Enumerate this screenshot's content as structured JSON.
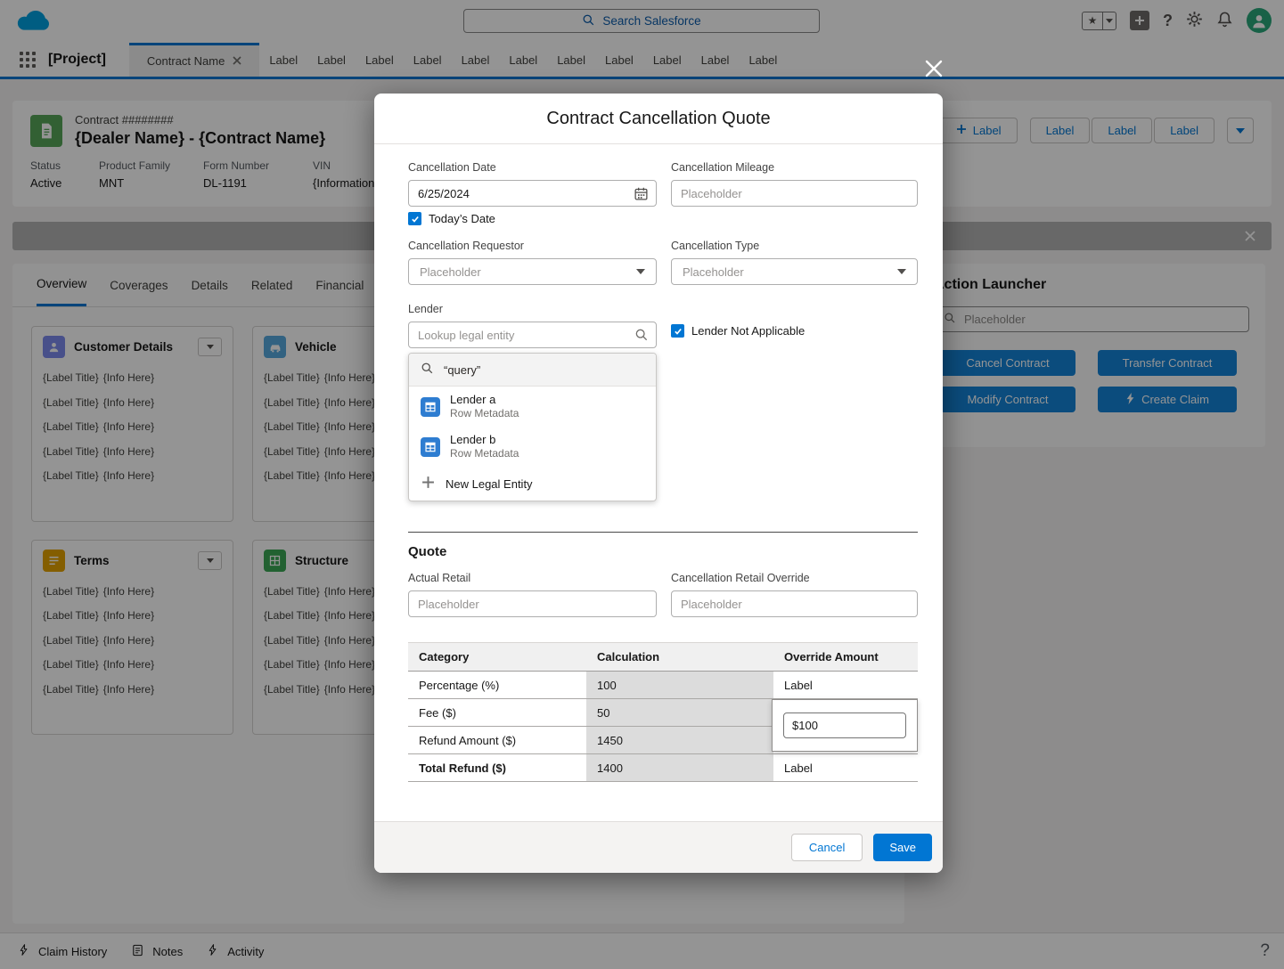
{
  "header": {
    "search_placeholder": "Search Salesforce"
  },
  "nav": {
    "project": "[Project]",
    "active_tab": "Contract Name",
    "tabs": [
      "Label",
      "Label",
      "Label",
      "Label",
      "Label",
      "Label",
      "Label",
      "Label",
      "Label",
      "Label",
      "Label"
    ]
  },
  "record": {
    "type_label": "Contract ########",
    "title": "{Dealer Name} - {Contract Name}",
    "add_button": "Label",
    "action_buttons": [
      "Label",
      "Label",
      "Label"
    ],
    "fields": [
      {
        "label": "Status",
        "value": "Active"
      },
      {
        "label": "Product Family",
        "value": "MNT"
      },
      {
        "label": "Form Number",
        "value": "DL-1191"
      },
      {
        "label": "VIN",
        "value": "{Information}"
      }
    ],
    "tabs": [
      "Overview",
      "Coverages",
      "Details",
      "Related",
      "Financial"
    ],
    "active_tab": "Overview",
    "kv_label": "{Label Title}",
    "kv_value": "{Info Here}",
    "cards": [
      {
        "title": "Customer Details"
      },
      {
        "title": "Vehicle"
      },
      {
        "title": "Terms"
      },
      {
        "title": "Structure"
      }
    ]
  },
  "launcher": {
    "title": "Action Launcher",
    "search_placeholder": "Placeholder",
    "buttons": [
      "Cancel Contract",
      "Transfer Contract",
      "Modify Contract",
      "Create Claim"
    ]
  },
  "modal": {
    "title": "Contract Cancellation Quote",
    "cancellation_date": {
      "label": "Cancellation Date",
      "value": "6/25/2024"
    },
    "todays_date_label": "Today’s Date",
    "cancellation_mileage": {
      "label": "Cancellation Mileage",
      "placeholder": "Placeholder"
    },
    "cancellation_requestor": {
      "label": "Cancellation Requestor",
      "placeholder": "Placeholder"
    },
    "cancellation_type": {
      "label": "Cancellation Type",
      "placeholder": "Placeholder"
    },
    "lender": {
      "label": "Lender",
      "placeholder": "Lookup legal entity"
    },
    "lender_na_label": "Lender Not Applicable",
    "lookup": {
      "query": "“query”",
      "results": [
        {
          "name": "Lender a",
          "meta": "Row Metadata"
        },
        {
          "name": "Lender b",
          "meta": "Row Metadata"
        }
      ],
      "new_label": "New Legal Entity"
    },
    "quote": {
      "heading": "Quote",
      "actual_retail": {
        "label": "Actual Retail",
        "placeholder": "Placeholder"
      },
      "retail_override": {
        "label": "Cancellation Retail Override",
        "placeholder": "Placeholder"
      }
    },
    "table": {
      "headers": [
        "Category",
        "Calculation",
        "Override Amount"
      ],
      "rows": [
        {
          "category": "Percentage (%)",
          "calculation": "100",
          "override": "Label"
        },
        {
          "category": "Fee ($)",
          "calculation": "50",
          "override": ""
        },
        {
          "category": "Refund Amount ($)",
          "calculation": "1450",
          "override": ""
        },
        {
          "category": "Total Refund ($)",
          "calculation": "1400",
          "override": "Label"
        }
      ],
      "override_input_value": "$100"
    },
    "footer": {
      "cancel": "Cancel",
      "save": "Save"
    }
  },
  "utility": {
    "items": [
      "Claim History",
      "Notes",
      "Activity"
    ],
    "help": "?"
  }
}
